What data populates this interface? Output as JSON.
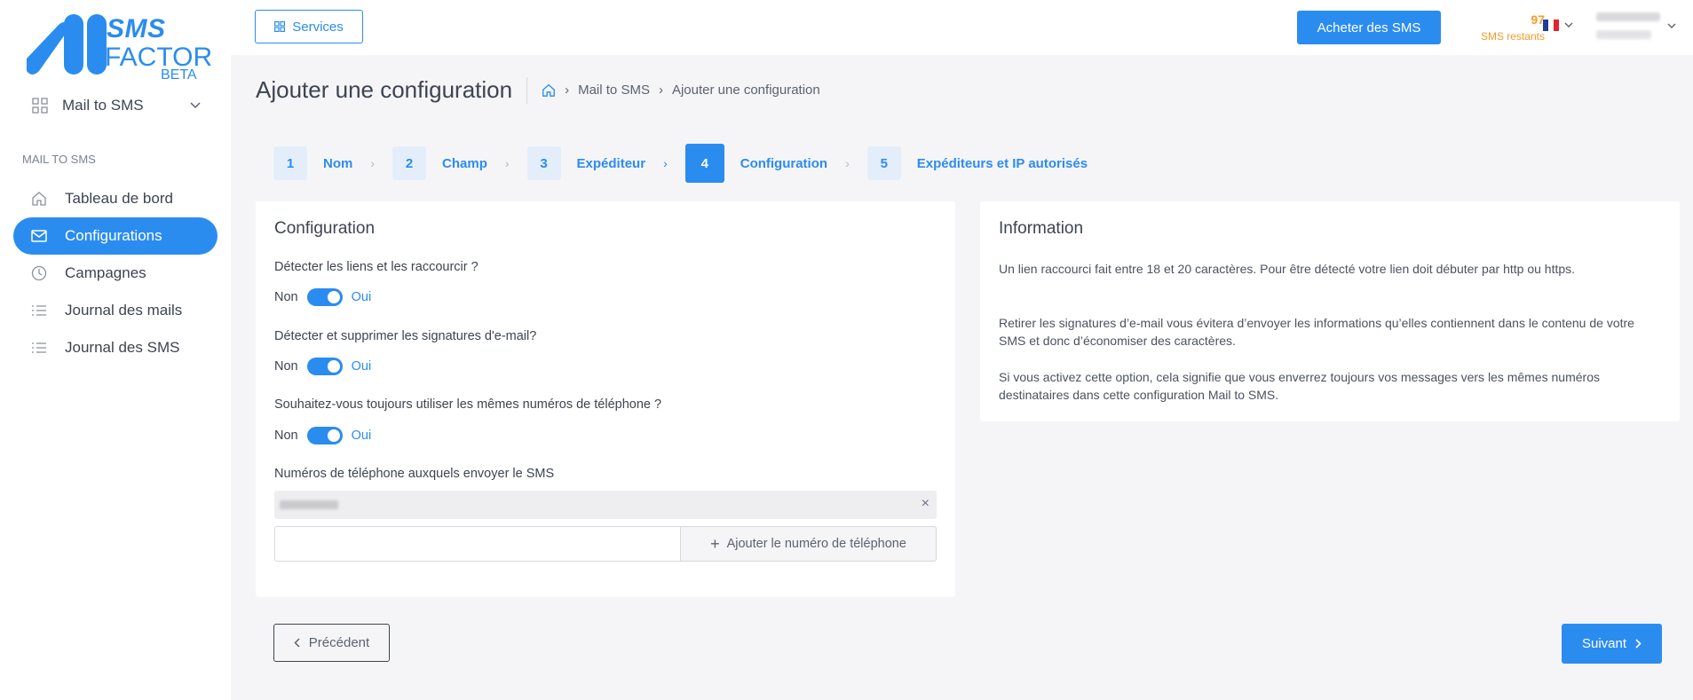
{
  "brand": {
    "line1": "SMS",
    "line2": "FACTOR",
    "line3": "BETA"
  },
  "sidebar": {
    "selector": "Mail to SMS",
    "heading": "MAIL TO SMS",
    "items": [
      {
        "label": "Tableau de bord",
        "icon": "home-icon"
      },
      {
        "label": "Configurations",
        "icon": "mail-icon",
        "active": true
      },
      {
        "label": "Campagnes",
        "icon": "clock-icon"
      },
      {
        "label": "Journal des mails",
        "icon": "list-icon"
      },
      {
        "label": "Journal des SMS",
        "icon": "list-icon"
      }
    ]
  },
  "topbar": {
    "services_label": "Services",
    "buy_label": "Acheter des SMS",
    "credits_value": "97",
    "credits_label": "SMS restants"
  },
  "page": {
    "title": "Ajouter une configuration",
    "breadcrumb": [
      "Mail to SMS",
      "Ajouter une configuration"
    ]
  },
  "steps": [
    {
      "num": "1",
      "label": "Nom"
    },
    {
      "num": "2",
      "label": "Champ"
    },
    {
      "num": "3",
      "label": "Expéditeur"
    },
    {
      "num": "4",
      "label": "Configuration",
      "current": true
    },
    {
      "num": "5",
      "label": "Expéditeurs et IP autorisés"
    }
  ],
  "config": {
    "title": "Configuration",
    "q1": "Détecter les liens et les raccourcir ?",
    "q2": "Détecter et supprimer les signatures d'e-mail?",
    "q3": "Souhaitez-vous toujours utiliser les mêmes numéros de téléphone ?",
    "no_label": "Non",
    "yes_label": "Oui",
    "phones_label": "Numéros de téléphone auxquels envoyer le SMS",
    "add_phone_label": "Ajouter le numéro de téléphone"
  },
  "info": {
    "title": "Information",
    "p1": "Un lien raccourci fait entre 18 et 20 caractères. Pour être détecté votre lien doit débuter par http ou https.",
    "p2": "Retirer les signatures d’e-mail vous évitera d’envoyer les informations qu’elles contiennent dans le contenu de votre SMS et donc d’économiser des caractères.",
    "p3": "Si vous activez cette option, cela signifie que vous enverrez toujours vos messages vers les mêmes numéros destinataires dans cette configuration Mail to SMS."
  },
  "footer": {
    "prev_label": "Précédent",
    "next_label": "Suivant"
  },
  "colors": {
    "accent": "#2b8cf0",
    "credits": "#f39c2b"
  }
}
